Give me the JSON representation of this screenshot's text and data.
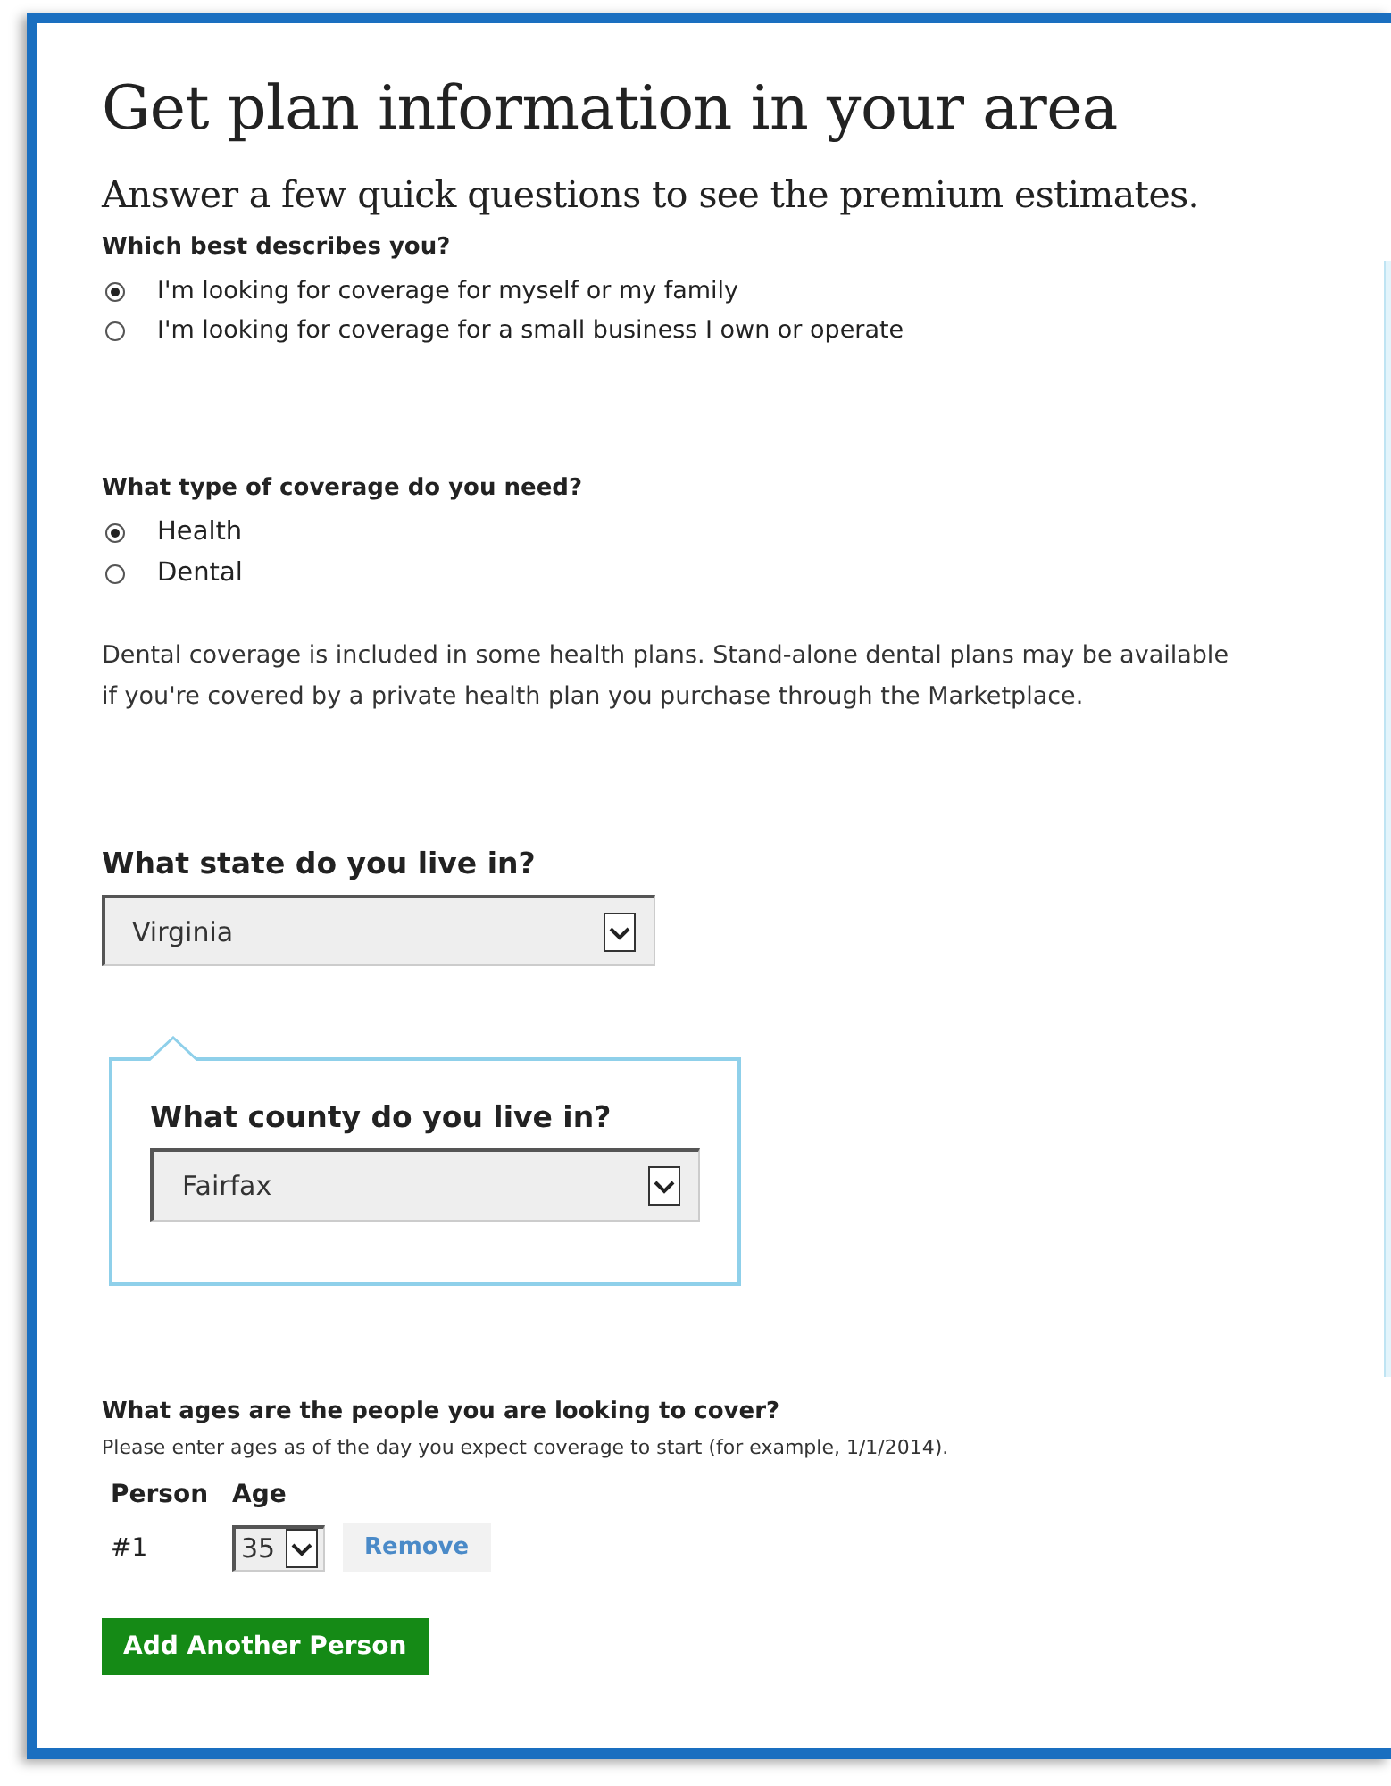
{
  "title": "Get plan information in your area",
  "subtitle": "Answer a few quick questions to see the premium estimates.",
  "who": {
    "label": "Which best describes you?",
    "options": [
      {
        "label": "I'm looking for coverage for myself or my family",
        "selected": true
      },
      {
        "label": "I'm looking for coverage for a small business I own or operate",
        "selected": false
      }
    ]
  },
  "coverage": {
    "label": "What type of coverage do you need?",
    "options": [
      {
        "label": "Health",
        "selected": true
      },
      {
        "label": "Dental",
        "selected": false
      }
    ],
    "note": "Dental coverage is included in some health plans. Stand-alone dental plans may be available if you're covered by a private health plan you purchase through the Marketplace."
  },
  "state": {
    "label": "What state do you live in?",
    "value": "Virginia"
  },
  "county": {
    "label": "What county do you live in?",
    "value": "Fairfax"
  },
  "ages": {
    "label": "What ages are the people you are looking to cover?",
    "hint": "Please enter ages as of the day you expect coverage to start (for example, 1/1/2014).",
    "columns": [
      "Person",
      "Age"
    ],
    "rows": [
      {
        "person": "#1",
        "age": "35",
        "action": "Remove"
      }
    ],
    "add_button": "Add Another Person"
  }
}
